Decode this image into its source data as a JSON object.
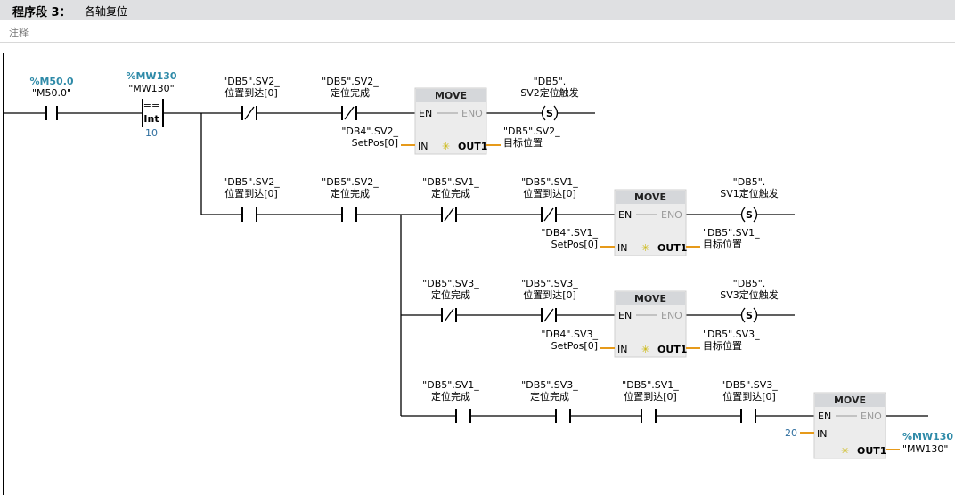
{
  "network": {
    "segment_label": "程序段 3：",
    "segment_name": "各轴复位",
    "comment_placeholder": "注释"
  },
  "rung1": {
    "c1": {
      "addr": "%M50.0",
      "tag": "\"M50.0\""
    },
    "cmp": {
      "addr": "%MW130",
      "tag": "\"MW130\"",
      "op": "==",
      "type": "Int",
      "value": "10"
    },
    "c2": {
      "l1": "\"DB5\".SV2_",
      "l2": "位置到达[0]"
    },
    "c3": {
      "l1": "\"DB5\".SV2_",
      "l2": "定位完成"
    },
    "move": {
      "title": "MOVE",
      "en": "EN",
      "eno": "ENO",
      "in": "IN",
      "out": "OUT1",
      "in_l1": "\"DB4\".SV2_",
      "in_l2": "SetPos[0]",
      "out_l1": "\"DB5\".SV2_",
      "out_l2": "目标位置"
    },
    "coil": {
      "l1": "\"DB5\".",
      "l2": "SV2定位触发",
      "sym": "S"
    }
  },
  "rung2": {
    "c1": {
      "l1": "\"DB5\".SV2_",
      "l2": "位置到达[0]"
    },
    "c2": {
      "l1": "\"DB5\".SV2_",
      "l2": "定位完成"
    },
    "c3": {
      "l1": "\"DB5\".SV1_",
      "l2": "定位完成"
    },
    "c4": {
      "l1": "\"DB5\".SV1_",
      "l2": "位置到达[0]"
    },
    "move": {
      "title": "MOVE",
      "en": "EN",
      "eno": "ENO",
      "in": "IN",
      "out": "OUT1",
      "in_l1": "\"DB4\".SV1_",
      "in_l2": "SetPos[0]",
      "out_l1": "\"DB5\".SV1_",
      "out_l2": "目标位置"
    },
    "coil": {
      "l1": "\"DB5\".",
      "l2": "SV1定位触发",
      "sym": "S"
    }
  },
  "rung3": {
    "c1": {
      "l1": "\"DB5\".SV3_",
      "l2": "定位完成"
    },
    "c2": {
      "l1": "\"DB5\".SV3_",
      "l2": "位置到达[0]"
    },
    "move": {
      "title": "MOVE",
      "en": "EN",
      "eno": "ENO",
      "in": "IN",
      "out": "OUT1",
      "in_l1": "\"DB4\".SV3_",
      "in_l2": "SetPos[0]",
      "out_l1": "\"DB5\".SV3_",
      "out_l2": "目标位置"
    },
    "coil": {
      "l1": "\"DB5\".",
      "l2": "SV3定位触发",
      "sym": "S"
    }
  },
  "rung4": {
    "c1": {
      "l1": "\"DB5\".SV1_",
      "l2": "定位完成"
    },
    "c2": {
      "l1": "\"DB5\".SV3_",
      "l2": "定位完成"
    },
    "c3": {
      "l1": "\"DB5\".SV1_",
      "l2": "位置到达[0]"
    },
    "c4": {
      "l1": "\"DB5\".SV3_",
      "l2": "位置到达[0]"
    },
    "move": {
      "title": "MOVE",
      "en": "EN",
      "eno": "ENO",
      "in": "IN",
      "out": "OUT1",
      "in_val": "20",
      "out_addr": "%MW130",
      "out_tag": "\"MW130\""
    }
  }
}
